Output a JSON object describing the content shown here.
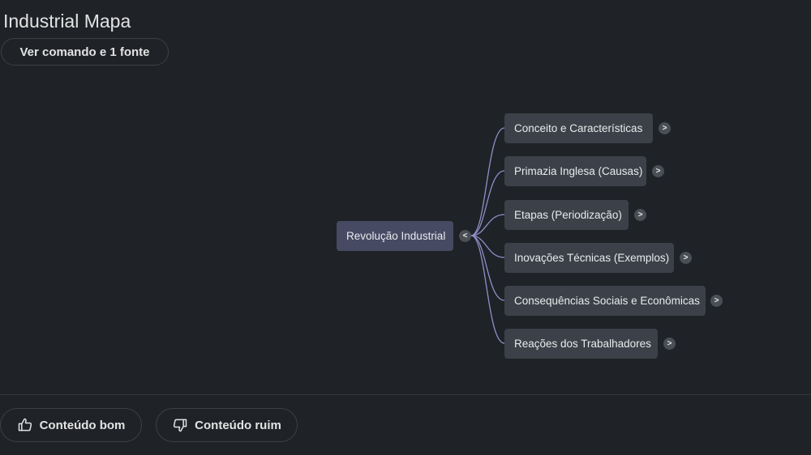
{
  "header": {
    "title": "Industrial Mapa",
    "source_button_label": "Ver comando e 1 fonte"
  },
  "mindmap": {
    "root": {
      "label": "Revolução Industrial",
      "toggle": "<"
    },
    "children": [
      {
        "label": "Conceito e Características",
        "toggle": ">"
      },
      {
        "label": "Primazia Inglesa (Causas)",
        "toggle": ">"
      },
      {
        "label": "Etapas (Periodização)",
        "toggle": ">"
      },
      {
        "label": "Inovações Técnicas (Exemplos)",
        "toggle": ">"
      },
      {
        "label": "Consequências Sociais e Econômicas",
        "toggle": ">"
      },
      {
        "label": "Reações dos Trabalhadores",
        "toggle": ">"
      }
    ],
    "colors": {
      "root_bg": "#474a63",
      "child_bg": "#3c4149",
      "connector": "#8f90c8"
    }
  },
  "footer": {
    "good_label": "Conteúdo bom",
    "bad_label": "Conteúdo ruim",
    "good_icon": "thumbs-up-icon",
    "bad_icon": "thumbs-down-icon"
  }
}
